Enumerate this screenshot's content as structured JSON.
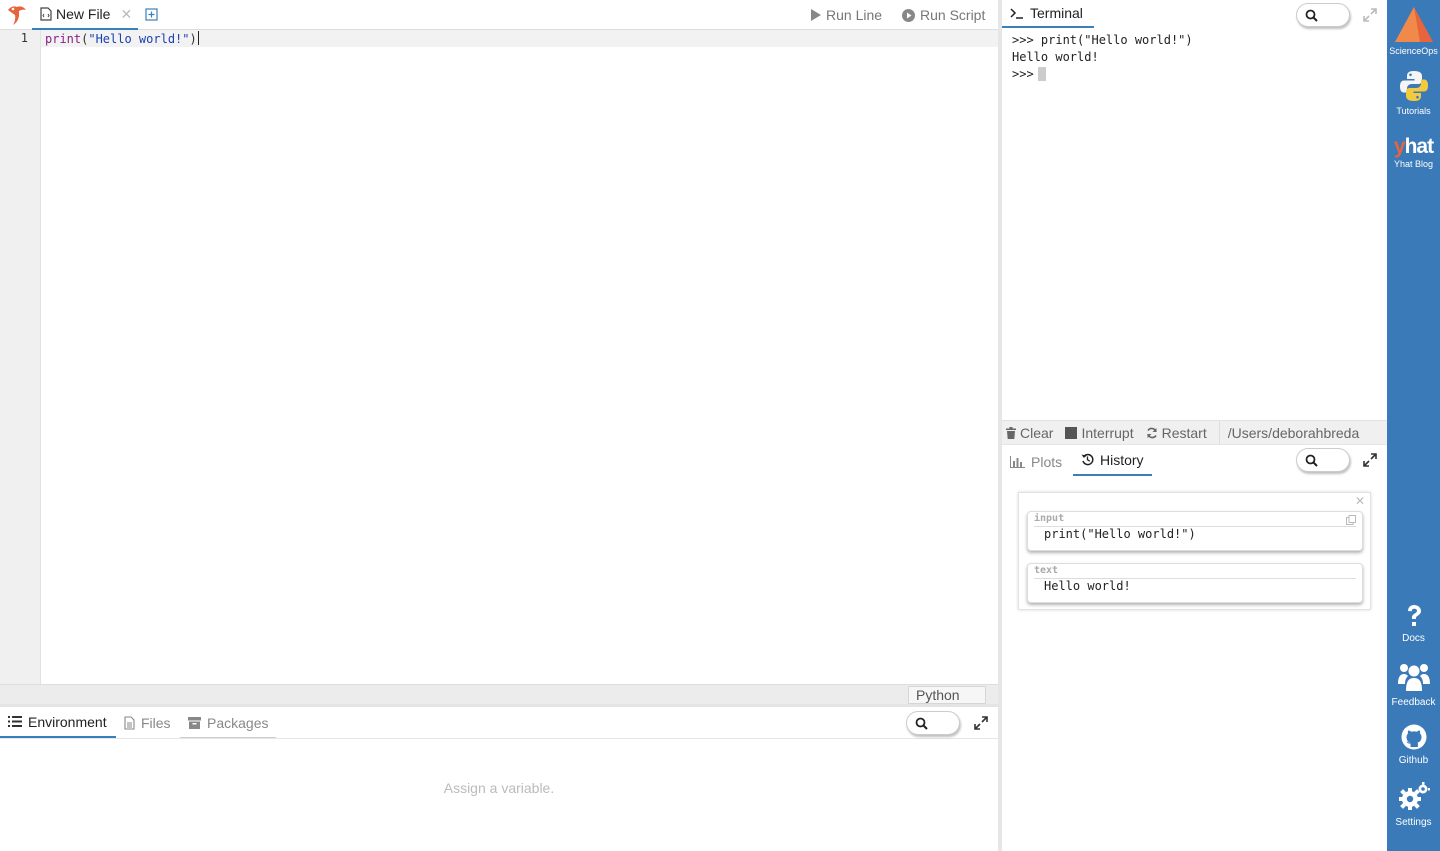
{
  "editor": {
    "tab_label": "New File",
    "close_glyph": "✕",
    "run_line_label": "Run Line",
    "run_script_label": "Run Script",
    "line_number": "1",
    "code": {
      "fn": "print",
      "open": "(",
      "str": "\"Hello world!\"",
      "close": ")"
    },
    "language": "Python"
  },
  "bottom_left": {
    "tabs": {
      "environment": "Environment",
      "files": "Files",
      "packages": "Packages"
    },
    "empty_message": "Assign a variable."
  },
  "terminal": {
    "tab_label": "Terminal",
    "lines": [
      ">>> print(\"Hello world!\")",
      "Hello world!"
    ],
    "prompt": ">>>",
    "toolbar": {
      "clear": "Clear",
      "interrupt": "Interrupt",
      "restart": "Restart",
      "path": "/Users/deborahbreda"
    }
  },
  "history_pane": {
    "tabs": {
      "plots": "Plots",
      "history": "History"
    },
    "close_glyph": "✕",
    "cells": [
      {
        "label": "input",
        "content": "print(\"Hello world!\")"
      },
      {
        "label": "text",
        "content": "Hello world!"
      }
    ]
  },
  "sidebar": {
    "scienceops": "ScienceOps",
    "tutorials": "Tutorials",
    "blog_logo_y": "y",
    "blog_logo_rest": "hat",
    "blog": "Yhat Blog",
    "docs": "Docs",
    "feedback": "Feedback",
    "github": "Github",
    "settings": "Settings"
  },
  "colors": {
    "sidebar_bg": "#3a7ab8",
    "active_tab_underline": "#3a80b8",
    "keyword": "#8b1e8b",
    "string": "#1a3fb0",
    "brand_orange": "#e8643a"
  }
}
